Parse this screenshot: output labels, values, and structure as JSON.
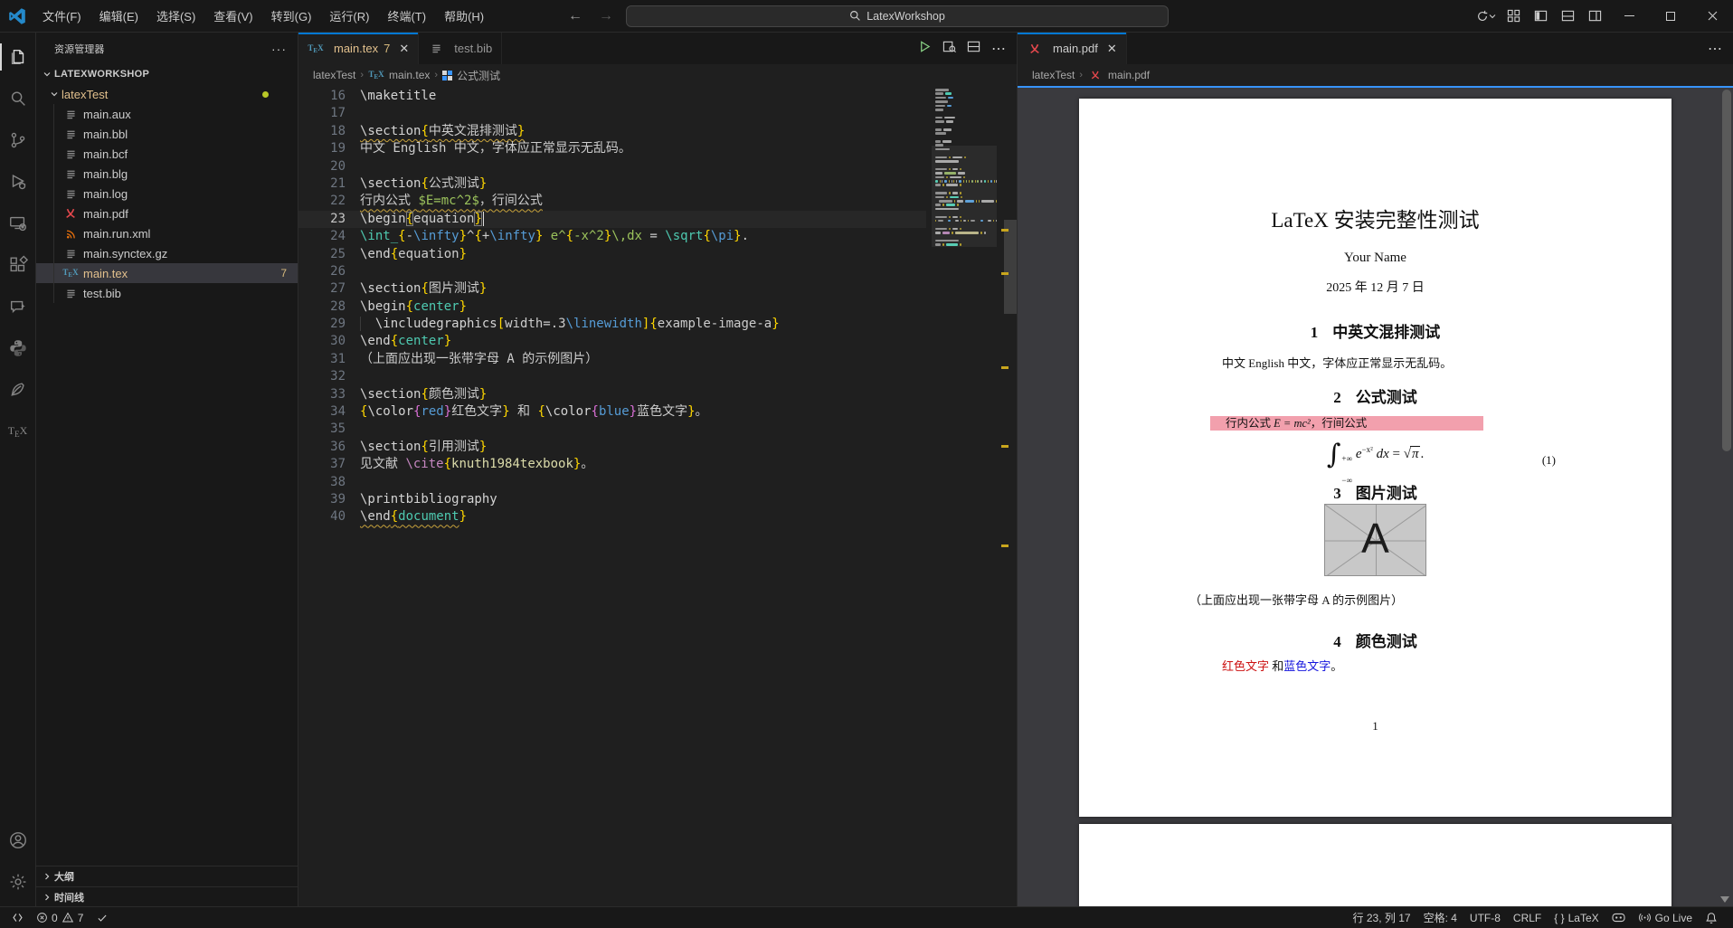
{
  "title_bar": {
    "menus": [
      "文件(F)",
      "编辑(E)",
      "选择(S)",
      "查看(V)",
      "转到(G)",
      "运行(R)",
      "终端(T)",
      "帮助(H)"
    ],
    "search_text": "LatexWorkshop"
  },
  "sidebar": {
    "header": "资源管理器",
    "workspace": "LATEXWORKSHOP",
    "folder": "latexTest",
    "files": [
      {
        "name": "main.aux",
        "icon": "file"
      },
      {
        "name": "main.bbl",
        "icon": "file"
      },
      {
        "name": "main.bcf",
        "icon": "file"
      },
      {
        "name": "main.blg",
        "icon": "file"
      },
      {
        "name": "main.log",
        "icon": "file"
      },
      {
        "name": "main.pdf",
        "icon": "pdf"
      },
      {
        "name": "main.run.xml",
        "icon": "rss"
      },
      {
        "name": "main.synctex.gz",
        "icon": "file"
      },
      {
        "name": "main.tex",
        "icon": "tex",
        "badge": "7",
        "selected": true,
        "modified": true
      },
      {
        "name": "test.bib",
        "icon": "file"
      }
    ],
    "outline": "大纲",
    "timeline": "时间线"
  },
  "editor": {
    "tab1": {
      "label": "main.tex",
      "badge": "7"
    },
    "tab2": {
      "label": "test.bib"
    },
    "breadcrumb": {
      "folder": "latexTest",
      "file": "main.tex",
      "symbol": "公式测试"
    },
    "lines": [
      {
        "n": 16,
        "t": [
          [
            "cmd",
            "\\maketitle"
          ]
        ]
      },
      {
        "n": 17,
        "t": []
      },
      {
        "n": 18,
        "t": [
          [
            "cmd sq",
            "\\section"
          ],
          [
            "b1 sq",
            "{"
          ],
          [
            "txt sq",
            "中英文混排测试"
          ],
          [
            "b1 sq",
            "}"
          ]
        ]
      },
      {
        "n": 19,
        "t": [
          [
            "txt",
            "中文 English 中文，字体应正常显示无乱码。"
          ]
        ]
      },
      {
        "n": 20,
        "t": []
      },
      {
        "n": 21,
        "t": [
          [
            "cmd",
            "\\section"
          ],
          [
            "b1",
            "{"
          ],
          [
            "txt",
            "公式测试"
          ],
          [
            "b1",
            "}"
          ]
        ]
      },
      {
        "n": 22,
        "t": [
          [
            "txt sq",
            "行内公式 "
          ],
          [
            "math sq",
            "$E=mc^2$"
          ],
          [
            "txt sq",
            "，行间公式"
          ]
        ]
      },
      {
        "n": 23,
        "cur": true,
        "t": [
          [
            "cmd",
            "\\begin"
          ],
          [
            "b1 box",
            "{"
          ],
          [
            "txt",
            "equation"
          ],
          [
            "b1 box",
            "}"
          ],
          [
            "caret",
            ""
          ]
        ]
      },
      {
        "n": 24,
        "t": [
          [
            "env",
            "\\int_"
          ],
          [
            "b1",
            "{"
          ],
          [
            "txt",
            "-"
          ],
          [
            "kw",
            "\\infty"
          ],
          [
            "b1",
            "}"
          ],
          [
            "txt",
            "^"
          ],
          [
            "b1",
            "{"
          ],
          [
            "txt",
            "+"
          ],
          [
            "kw",
            "\\infty"
          ],
          [
            "b1",
            "}"
          ],
          [
            "math",
            " e^"
          ],
          [
            "b1",
            "{"
          ],
          [
            "math",
            "-x^2"
          ],
          [
            "b1",
            "}"
          ],
          [
            "math",
            "\\,dx"
          ],
          [
            "txt",
            " = "
          ],
          [
            "env",
            "\\sqrt"
          ],
          [
            "b1",
            "{"
          ],
          [
            "kw",
            "\\pi"
          ],
          [
            "b1",
            "}"
          ],
          [
            "txt",
            "."
          ]
        ]
      },
      {
        "n": 25,
        "t": [
          [
            "cmd",
            "\\end"
          ],
          [
            "b1",
            "{"
          ],
          [
            "txt",
            "equation"
          ],
          [
            "b1",
            "}"
          ]
        ]
      },
      {
        "n": 26,
        "t": []
      },
      {
        "n": 27,
        "t": [
          [
            "cmd",
            "\\section"
          ],
          [
            "b1",
            "{"
          ],
          [
            "txt",
            "图片测试"
          ],
          [
            "b1",
            "}"
          ]
        ]
      },
      {
        "n": 28,
        "t": [
          [
            "cmd",
            "\\begin"
          ],
          [
            "b1",
            "{"
          ],
          [
            "env",
            "center"
          ],
          [
            "b1",
            "}"
          ]
        ]
      },
      {
        "n": 29,
        "t": [
          [
            "ind",
            "  "
          ],
          [
            "cmd",
            "\\includegraphics"
          ],
          [
            "b1",
            "["
          ],
          [
            "txt",
            "width=.3"
          ],
          [
            "kw",
            "\\linewidth"
          ],
          [
            "b1",
            "]"
          ],
          [
            "b1",
            "{"
          ],
          [
            "txt",
            "example-image-a"
          ],
          [
            "b1",
            "}"
          ]
        ]
      },
      {
        "n": 30,
        "t": [
          [
            "cmd",
            "\\end"
          ],
          [
            "b1",
            "{"
          ],
          [
            "env",
            "center"
          ],
          [
            "b1",
            "}"
          ]
        ]
      },
      {
        "n": 31,
        "t": [
          [
            "txt",
            "（上面应出现一张带字母 A 的示例图片）"
          ]
        ]
      },
      {
        "n": 32,
        "t": []
      },
      {
        "n": 33,
        "t": [
          [
            "cmd",
            "\\section"
          ],
          [
            "b1",
            "{"
          ],
          [
            "txt",
            "颜色测试"
          ],
          [
            "b1",
            "}"
          ]
        ]
      },
      {
        "n": 34,
        "t": [
          [
            "b1",
            "{"
          ],
          [
            "cmd",
            "\\color"
          ],
          [
            "b2",
            "{"
          ],
          [
            "kw",
            "red"
          ],
          [
            "b2",
            "}"
          ],
          [
            "txt",
            "红色文字"
          ],
          [
            "b1",
            "}"
          ],
          [
            "txt",
            " 和 "
          ],
          [
            "b1",
            "{"
          ],
          [
            "cmd",
            "\\color"
          ],
          [
            "b2",
            "{"
          ],
          [
            "kw",
            "blue"
          ],
          [
            "b2",
            "}"
          ],
          [
            "txt",
            "蓝色文字"
          ],
          [
            "b1",
            "}"
          ],
          [
            "txt",
            "。"
          ]
        ]
      },
      {
        "n": 35,
        "t": []
      },
      {
        "n": 36,
        "t": [
          [
            "cmd",
            "\\section"
          ],
          [
            "b1",
            "{"
          ],
          [
            "txt",
            "引用测试"
          ],
          [
            "b1",
            "}"
          ]
        ]
      },
      {
        "n": 37,
        "t": [
          [
            "txt",
            "见文献 "
          ],
          [
            "cite",
            "\\cite"
          ],
          [
            "b1",
            "{"
          ],
          [
            "key",
            "knuth1984texbook"
          ],
          [
            "b1",
            "}"
          ],
          [
            "txt",
            "。"
          ]
        ]
      },
      {
        "n": 38,
        "t": []
      },
      {
        "n": 39,
        "t": [
          [
            "cmd",
            "\\printbibliography"
          ]
        ]
      },
      {
        "n": 40,
        "t": [
          [
            "cmd sq",
            "\\end"
          ],
          [
            "b1 sq",
            "{"
          ],
          [
            "env sq",
            "document"
          ],
          [
            "b1",
            "}"
          ]
        ]
      }
    ]
  },
  "pdf_pane": {
    "tab": "main.pdf",
    "breadcrumb": {
      "folder": "latexTest",
      "file": "main.pdf"
    },
    "page1": {
      "title": "LaTeX 安装完整性测试",
      "author": "Your Name",
      "date": "2025 年 12 月 7 日",
      "sec1_num": "1",
      "sec1_title": "中英文混排测试",
      "para1": "中文 English 中文，字体应正常显示无乱码。",
      "sec2_num": "2",
      "sec2_title": "公式测试",
      "hl_pre": "行内公式 ",
      "hl_formula": "E = mc²",
      "hl_post": "，行间公式",
      "eq_int": "∫",
      "eq_sup": "+∞",
      "eq_sub": "−∞",
      "eq_e": "e",
      "eq_exp": "−x²",
      "eq_dx": " dx",
      "eq_equals": " = ",
      "eq_sqrt": "√",
      "eq_pi": "π",
      "eq_period": ".",
      "eq_tag": "(1)",
      "sec3_num": "3",
      "sec3_title": "图片测试",
      "image_letter": "A",
      "caption": "（上面应出现一张带字母 A 的示例图片）",
      "sec4_num": "4",
      "sec4_title": "颜色测试",
      "color_red": "红色文字",
      "color_mid": " 和",
      "color_blue": "蓝色文字",
      "color_end": "。",
      "page_number": "1"
    }
  },
  "status_bar": {
    "errors": "0",
    "warnings": "7",
    "cursor": "行 23, 列 17",
    "spaces": "空格: 4",
    "encoding": "UTF-8",
    "eol": "CRLF",
    "braces": "{ }",
    "language": "LaTeX",
    "go_live": "Go Live"
  }
}
